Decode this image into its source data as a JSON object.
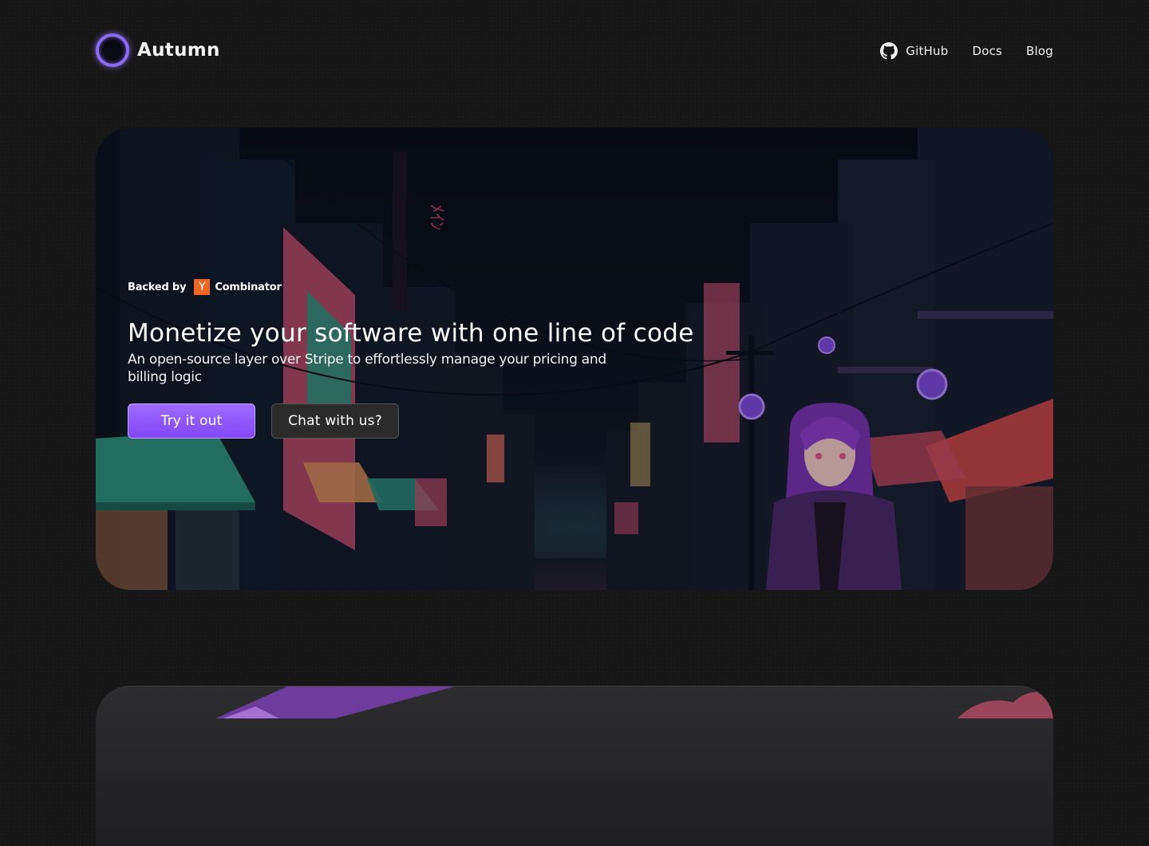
{
  "brand": {
    "name": "Autumn",
    "icon": "ring-logo-icon"
  },
  "nav": {
    "github": {
      "label": "GitHub",
      "icon": "github-icon"
    },
    "docs": "Docs",
    "blog": "Blog"
  },
  "hero": {
    "backed_by": "Backed by",
    "yc_letter": "Y",
    "yc_name": "Combinator",
    "headline": "Monetize your software with one line of code",
    "subheadline": "An open-source layer over Stripe to effortlessly manage your pricing and billing logic",
    "primary_button": "Try it out",
    "secondary_button": "Chat with us?"
  },
  "colors": {
    "background": "#161616",
    "accent_purple": "#8b5cf6",
    "yc_orange": "#f26625",
    "secondary_button": "#2b2b2b"
  }
}
